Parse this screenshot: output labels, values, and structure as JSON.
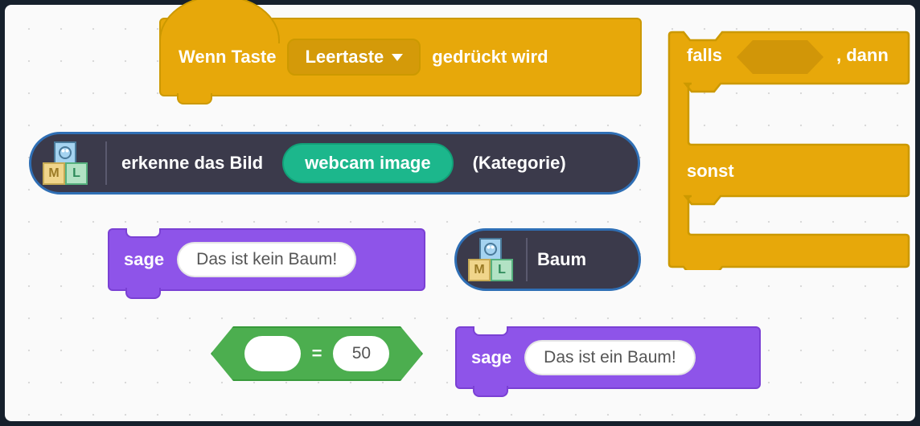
{
  "hat": {
    "prefix": "Wenn Taste",
    "key": "Leertaste",
    "suffix": "gedrückt wird"
  },
  "ml_recognise": {
    "label": "erkenne das Bild",
    "param": "webcam image",
    "suffix": "(Kategorie)"
  },
  "ml_label": {
    "text": "Baum"
  },
  "say1": {
    "label": "sage",
    "value": "Das ist kein Baum!"
  },
  "say2": {
    "label": "sage",
    "value": "Das ist ein Baum!"
  },
  "operator": {
    "left": "",
    "op": "=",
    "right": "50"
  },
  "ifelse": {
    "if": "falls",
    "then": ", dann",
    "else": "sonst"
  },
  "ml_icon": {
    "letter_m": "M",
    "letter_l": "L"
  }
}
